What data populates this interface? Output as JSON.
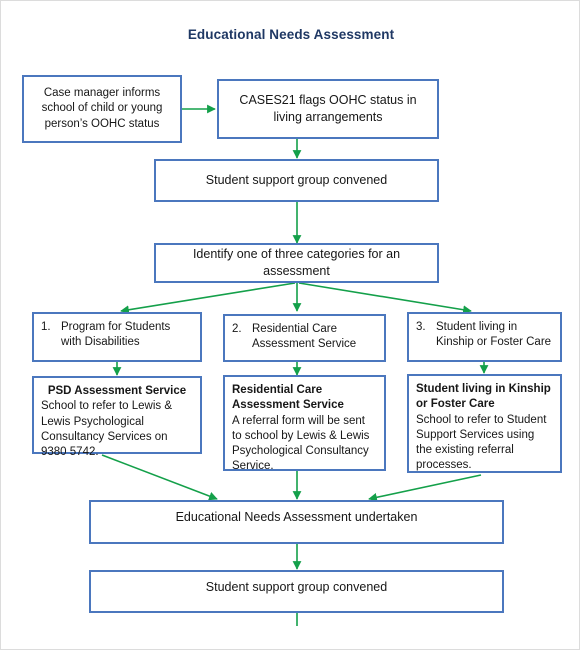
{
  "title": "Educational Needs Assessment",
  "colors": {
    "title_text": "#1F3864",
    "box_border": "#4B77BE",
    "arrow": "#14A04A",
    "body_text": "#171717",
    "page_background": "#FFFFFF"
  },
  "nodes": {
    "case_manager": "Case manager informs school of child or young person’s OOHC status",
    "cases21": "CASES21 flags OOHC status in living arrangements",
    "ssg_top": "Student support group convened",
    "identify": "Identify one of three categories for an assessment",
    "category_1": {
      "number": "1.",
      "label": "Program for Students with Disabilities"
    },
    "category_2": {
      "number": "2.",
      "label": "Residential Care Assessment Service"
    },
    "category_3": {
      "number": "3.",
      "label": "Student living in Kinship or Foster Care"
    },
    "detail_1": {
      "heading": "PSD Assessment Service",
      "body": "School to refer to Lewis & Lewis Psychological Consultancy Services on 9380 5742."
    },
    "detail_2": {
      "heading": "Residential Care Assessment Service",
      "body": "A referral form will be sent to school by Lewis & Lewis Psychological Consultancy Service."
    },
    "detail_3": {
      "heading": "Student living in Kinship or Foster Care",
      "body": "School to refer to Student Support Services using the existing referral processes."
    },
    "ena_undertaken": "Educational Needs Assessment undertaken",
    "ssg_bottom": "Student support group convened"
  }
}
